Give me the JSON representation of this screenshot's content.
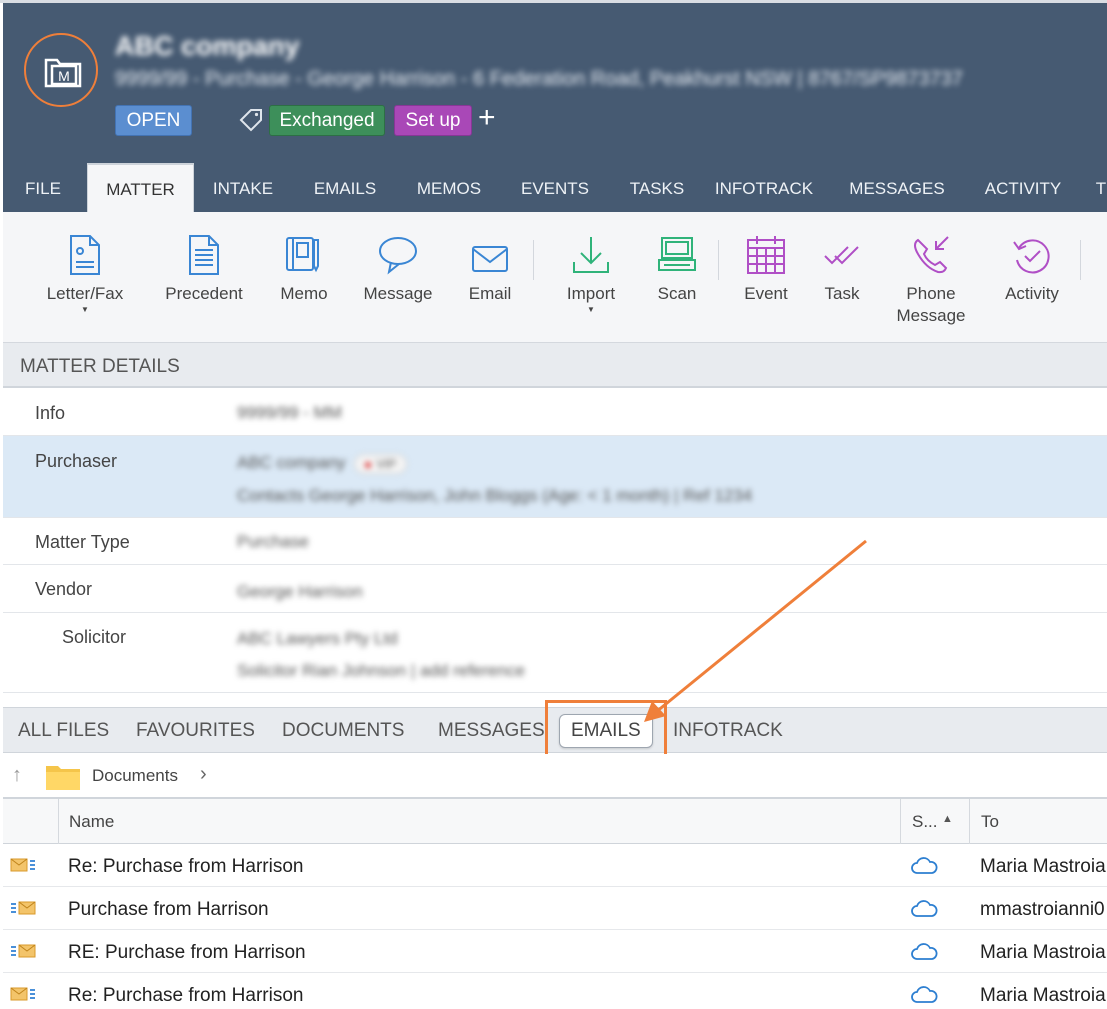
{
  "breadcrumb_top": "",
  "header": {
    "title": "ABC company",
    "subtitle": "9999/99 - Purchase - George Harrison - 6 Federation Road, Peakhurst NSW | 8767/SP9873737",
    "status": "OPEN",
    "tags": [
      "Exchanged",
      "Set up"
    ],
    "add_tag": "+",
    "colors": {
      "header_bg": "#465a72",
      "accent": "#ef7f3a",
      "open": "#5b8ed0",
      "exchanged": "#3d8f5a",
      "setup": "#a948b7"
    }
  },
  "tabs": [
    "FILE",
    "MATTER",
    "INTAKE",
    "EMAILS",
    "MEMOS",
    "EVENTS",
    "TASKS",
    "INFOTRACK",
    "MESSAGES",
    "ACTIVITY",
    "T"
  ],
  "active_tab": "MATTER",
  "ribbon": {
    "letter": "Letter/Fax",
    "precedent": "Precedent",
    "memo": "Memo",
    "message": "Message",
    "email": "Email",
    "import": "Import",
    "scan": "Scan",
    "event": "Event",
    "task": "Task",
    "phone_line1": "Phone",
    "phone_line2": "Message",
    "activity": "Activity"
  },
  "matter_details": {
    "heading": "MATTER DETAILS",
    "rows": [
      {
        "label": "Info",
        "value": "9999/99 - MM"
      },
      {
        "label": "Purchaser",
        "value": "ABC company",
        "badge": "VIP",
        "sub": "Contacts George Harrison, John Bloggs (Age: < 1 month) | Ref 1234"
      },
      {
        "label": "Matter Type",
        "value": "Purchase"
      },
      {
        "label": "Vendor",
        "value": "George Harrison"
      },
      {
        "label": "Solicitor",
        "value": "ABC Lawyers Pty Ltd",
        "sub": "Solicitor Rian Johnson | add reference"
      }
    ]
  },
  "file_tabs": [
    "ALL FILES",
    "FAVOURITES",
    "DOCUMENTS",
    "MESSAGES",
    "EMAILS",
    "INFOTRACK"
  ],
  "active_file_tab": "EMAILS",
  "crumbs": {
    "folder": "Documents"
  },
  "table": {
    "columns": {
      "name": "Name",
      "status": "S...",
      "to": "To"
    },
    "rows": [
      {
        "name": "Re: Purchase from Harrison",
        "to": "Maria Mastroia",
        "icon": "mail-received-icon"
      },
      {
        "name": "Purchase from Harrison",
        "to": "mmastroianni0",
        "icon": "mail-sent-icon"
      },
      {
        "name": "RE: Purchase from Harrison",
        "to": "Maria Mastroia",
        "icon": "mail-sent-icon"
      },
      {
        "name": "Re: Purchase from Harrison",
        "to": "Maria Mastroia",
        "icon": "mail-received-icon"
      }
    ]
  }
}
